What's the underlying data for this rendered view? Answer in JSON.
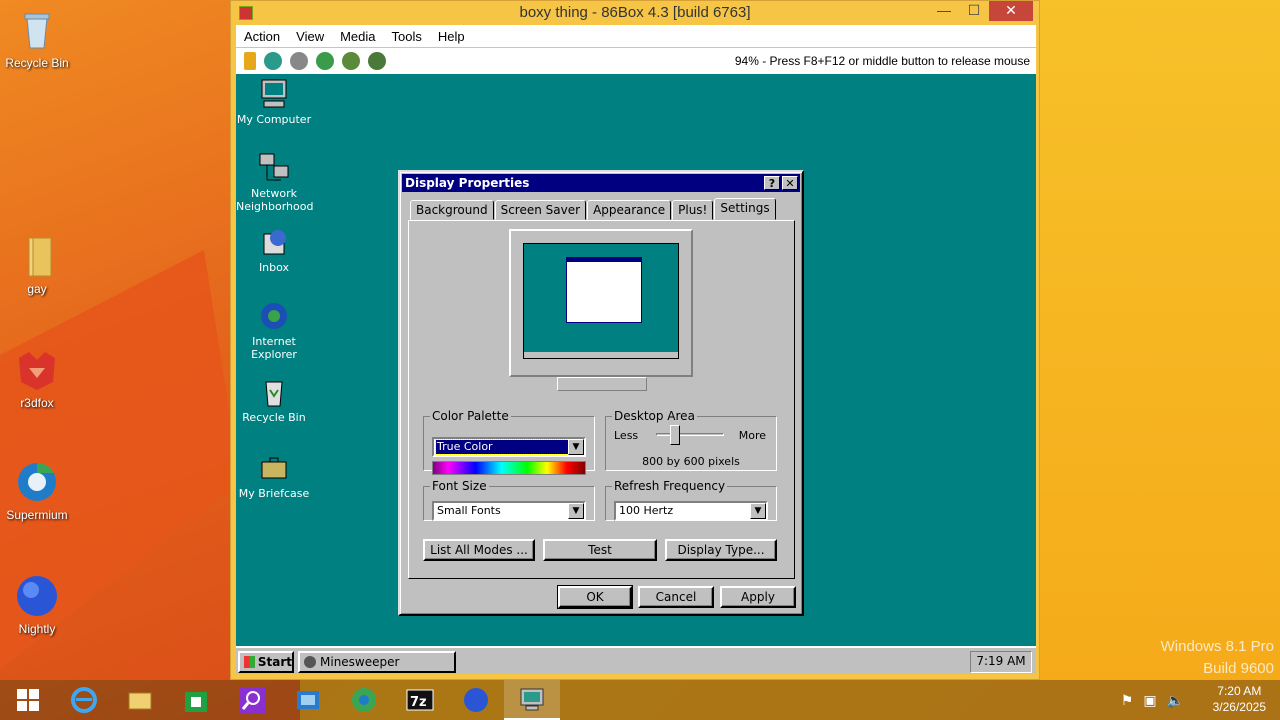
{
  "host": {
    "desktop_icons": [
      {
        "label": "Recycle Bin",
        "icon": "recycle-bin-icon"
      },
      {
        "label": "gay",
        "icon": "folder-icon"
      },
      {
        "label": "r3dfox",
        "icon": "r3dfox-icon"
      },
      {
        "label": "Supermium",
        "icon": "supermium-icon"
      },
      {
        "label": "Nightly",
        "icon": "nightly-icon"
      }
    ],
    "watermark": {
      "line1": "Windows 8.1 Pro",
      "line2": "Build 9600"
    },
    "clock": {
      "time": "7:20 AM",
      "date": "3/26/2025"
    },
    "taskbar_items": [
      "start-icon",
      "ie-icon",
      "explorer-icon",
      "store-icon",
      "search-icon",
      "control-panel-icon",
      "supermium-icon",
      "7zip-icon",
      "nightly-icon",
      "86box-icon"
    ]
  },
  "vm_window": {
    "title": "boxy thing - 86Box 4.3 [build 6763]",
    "menu": [
      "Action",
      "View",
      "Media",
      "Tools",
      "Help"
    ],
    "status": "94% - Press F8+F12 or middle button to release mouse"
  },
  "guest": {
    "desktop_icons": [
      {
        "label": "My Computer"
      },
      {
        "label": "Network Neighborhood"
      },
      {
        "label": "Inbox"
      },
      {
        "label": "Internet Explorer"
      },
      {
        "label": "Recycle Bin"
      },
      {
        "label": "My Briefcase"
      }
    ],
    "dialog": {
      "title": "Display Properties",
      "help_btn": "?",
      "close_btn": "✕",
      "tabs": [
        "Background",
        "Screen Saver",
        "Appearance",
        "Plus!",
        "Settings"
      ],
      "color_palette": {
        "legend": "Color Palette",
        "value": "True Color"
      },
      "desktop_area": {
        "legend": "Desktop Area",
        "less": "Less",
        "more": "More",
        "value": "800 by 600 pixels",
        "level": 0.3
      },
      "font_size": {
        "legend": "Font Size",
        "value": "Small Fonts"
      },
      "refresh": {
        "legend": "Refresh Frequency",
        "value": "100 Hertz"
      },
      "buttons": {
        "list_modes": "List All Modes ...",
        "test": "Test",
        "display_type": "Display Type...",
        "ok": "OK",
        "cancel": "Cancel",
        "apply": "Apply"
      }
    },
    "taskbar": {
      "start": "Start",
      "task": "Minesweeper",
      "clock": "7:19 AM"
    }
  },
  "colors": {
    "guest_desktop": "#008080",
    "title_bar": "#000080",
    "face": "#c0c0c0"
  }
}
